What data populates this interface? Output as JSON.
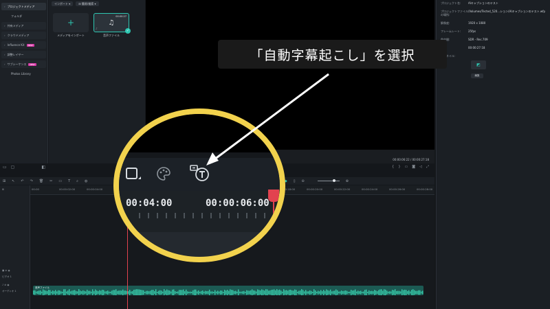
{
  "sidebar": {
    "items": [
      {
        "label": "プロジェクトメディア",
        "active": true
      },
      {
        "label": "フォルダ",
        "plain": true
      },
      {
        "label": "共有メディア"
      },
      {
        "label": "クラウドメディア"
      },
      {
        "label": "Influence Kit",
        "badge": "NEW"
      },
      {
        "label": "調整レイヤー"
      },
      {
        "label": "サブシーケンス",
        "badge": "NEW"
      },
      {
        "label": "Photos Library",
        "plain": true
      }
    ]
  },
  "media": {
    "import_label": "インポート",
    "filter_label": "簡易/検索",
    "import_tile_label": "メディアをインポート",
    "audio_tile_label": "音声ファイル",
    "audio_tile_duration": "00:00:27"
  },
  "preview": {
    "time_current": "00:00:06:22",
    "time_total": "00:00:27:18"
  },
  "props": {
    "rows": [
      {
        "key": "プロジェクト名:",
        "value": "AIキャプションのテスト"
      },
      {
        "key": "プロジェクトファイルの場所:",
        "value": "/Volumes/Tected_520...ション(AIキャプションのテスト.wfp"
      },
      {
        "key": "解像度:",
        "value": "1920 x 1080"
      },
      {
        "key": "フレームレート:",
        "value": "25fps"
      },
      {
        "key": "色空間:",
        "value": "SDR - Rec.709"
      },
      {
        "key": "長さ:",
        "value": "00:00:27:18"
      },
      {
        "key": "サムネイル:",
        "value": ""
      }
    ],
    "edit_label": "編集"
  },
  "timeline": {
    "ruler_labels": [
      "00:00",
      "00:00:02:00",
      "00:00:04:00",
      "00:00:06:00",
      "00:00:08:00",
      "00:00:10:00",
      "00:00:12:00",
      "00:00:14:00",
      "00:00:16:00",
      "00:00:18:00",
      "00:00:20:00",
      "00:00:22:00",
      "00:00:24:00",
      "00:00:26:00",
      "00:00:28:00"
    ],
    "video_track_label": "ビデオ 1",
    "audio_track_label": "オーディオ 1",
    "audio_clip_name": "音声ファイル"
  },
  "magnifier": {
    "time_left": "00:04:00",
    "time_right": "00:00:06:00"
  },
  "callout": {
    "text": "「自動字幕起こし」を選択"
  },
  "colors": {
    "accent": "#2ec6b1",
    "highlight": "#f2d24d",
    "playhead": "#e2424f"
  }
}
